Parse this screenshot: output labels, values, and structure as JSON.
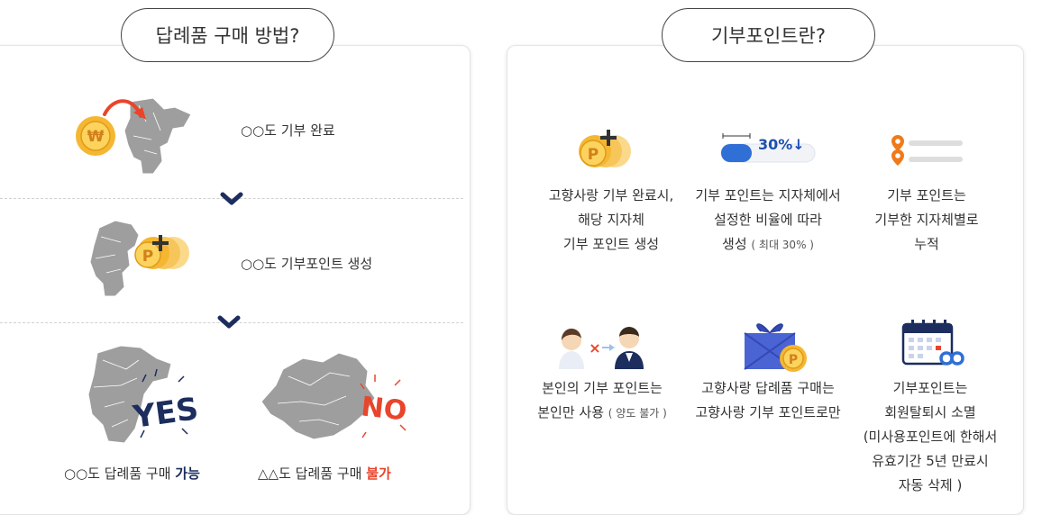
{
  "left": {
    "title": "답례품 구매 방법?",
    "steps": [
      {
        "label": "○○도 기부 완료"
      },
      {
        "label": "○○도 기부포인트 생성"
      }
    ],
    "yes_label_prefix": "○○도 답례품 구매 ",
    "yes_label_emph": "가능",
    "no_label_prefix": "△△도 답례품 구매 ",
    "no_label_emph": "불가",
    "yes_stamp": "YES",
    "no_stamp": "NO"
  },
  "right": {
    "title": "기부포인트란?",
    "percent_badge": "30%↓",
    "items": [
      {
        "lines": [
          "고향사랑 기부 완료시,",
          "해당 지자체",
          "기부 포인트 생성"
        ]
      },
      {
        "lines": [
          "기부 포인트는 지자체에서",
          "설정한 비율에 따라"
        ],
        "last": "생성",
        "note": "( 최대 30% )"
      },
      {
        "lines": [
          "기부 포인트는",
          "기부한 지자체별로",
          "누적"
        ]
      },
      {
        "lines": [
          "본인의 기부 포인트는"
        ],
        "last": "본인만 사용",
        "note": "( 양도 불가 )"
      },
      {
        "lines": [
          "고향사랑 답례품 구매는",
          "고향사랑 기부 포인트로만"
        ]
      },
      {
        "lines": [
          "기부포인트는",
          "회원탈퇴시 소멸",
          "(미사용포인트에 한해서",
          "유효기간 5년 만료시",
          "자동 삭제 )"
        ]
      }
    ]
  },
  "colors": {
    "coin": "#f5b731",
    "navy": "#1c2d5e",
    "red": "#e8452b",
    "map": "#9e9e9e",
    "blue": "#2f6fd6"
  }
}
